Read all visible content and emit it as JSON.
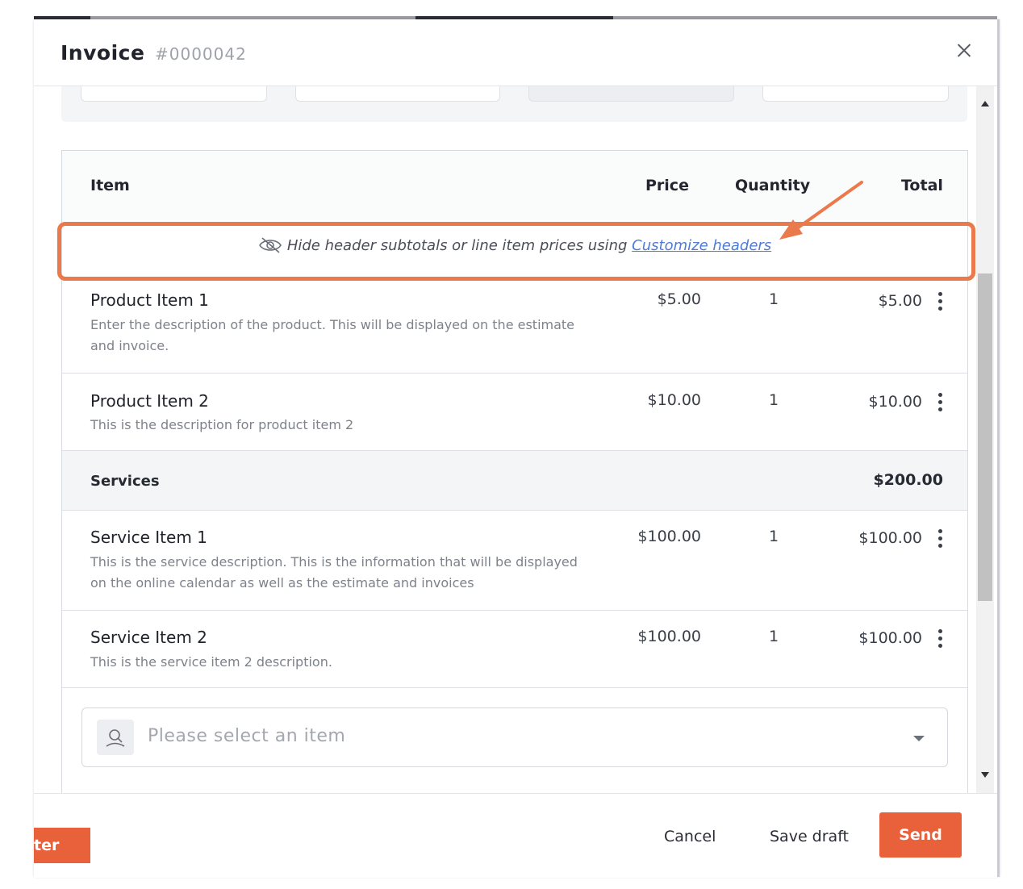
{
  "modal": {
    "title": "Invoice",
    "number": "#0000042"
  },
  "table": {
    "headers": {
      "item": "Item",
      "price": "Price",
      "quantity": "Quantity",
      "total": "Total"
    },
    "hint": {
      "text": "Hide header subtotals or line item prices using",
      "link": "Customize headers"
    },
    "products": [
      {
        "name": "Product Item 1",
        "description": "Enter the description of the product. This will be displayed on the estimate and invoice.",
        "price": "$5.00",
        "quantity": "1",
        "total": "$5.00"
      },
      {
        "name": "Product Item 2",
        "description": "This is the description for product item 2",
        "price": "$10.00",
        "quantity": "1",
        "total": "$10.00"
      }
    ],
    "section": {
      "name": "Services",
      "total": "$200.00"
    },
    "services": [
      {
        "name": "Service Item 1",
        "description": "This is the service description. This is the information that will be displayed on the online calendar as well as the estimate and invoices",
        "price": "$100.00",
        "quantity": "1",
        "total": "$100.00"
      },
      {
        "name": "Service Item 2",
        "description": "This is the service item 2 description.",
        "price": "$100.00",
        "quantity": "1",
        "total": "$100.00"
      }
    ],
    "select": {
      "placeholder": "Please select an item"
    }
  },
  "footer": {
    "partial_label": "ter",
    "cancel": "Cancel",
    "save_draft": "Save draft",
    "send": "Send"
  },
  "colors": {
    "accent": "#e8613a",
    "annotation": "#ea7a4c",
    "link": "#4c7bd8"
  },
  "icons": [
    "close-icon",
    "eye-slash-icon",
    "kebab-menu-icon",
    "item-search-icon",
    "chevron-down-icon",
    "scroll-up-icon",
    "scroll-down-icon"
  ]
}
